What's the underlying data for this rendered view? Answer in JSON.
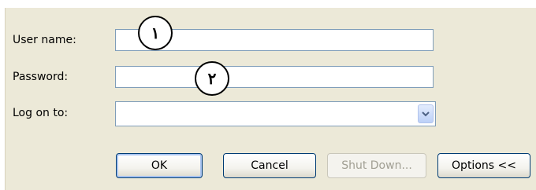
{
  "form": {
    "username_label": "User name:",
    "username_value": "",
    "password_label": "Password:",
    "password_value": "",
    "logon_label": "Log on to:",
    "logon_value": ""
  },
  "callouts": {
    "one": "١",
    "two": "٢"
  },
  "buttons": {
    "ok": "OK",
    "cancel": "Cancel",
    "shutdown": "Shut Down...",
    "options": "Options <<"
  },
  "icons": {
    "dropdown": "chevron-down-icon"
  },
  "colors": {
    "dialog_bg": "#ece9d8",
    "field_border": "#7f9db9",
    "button_border": "#003c74"
  }
}
